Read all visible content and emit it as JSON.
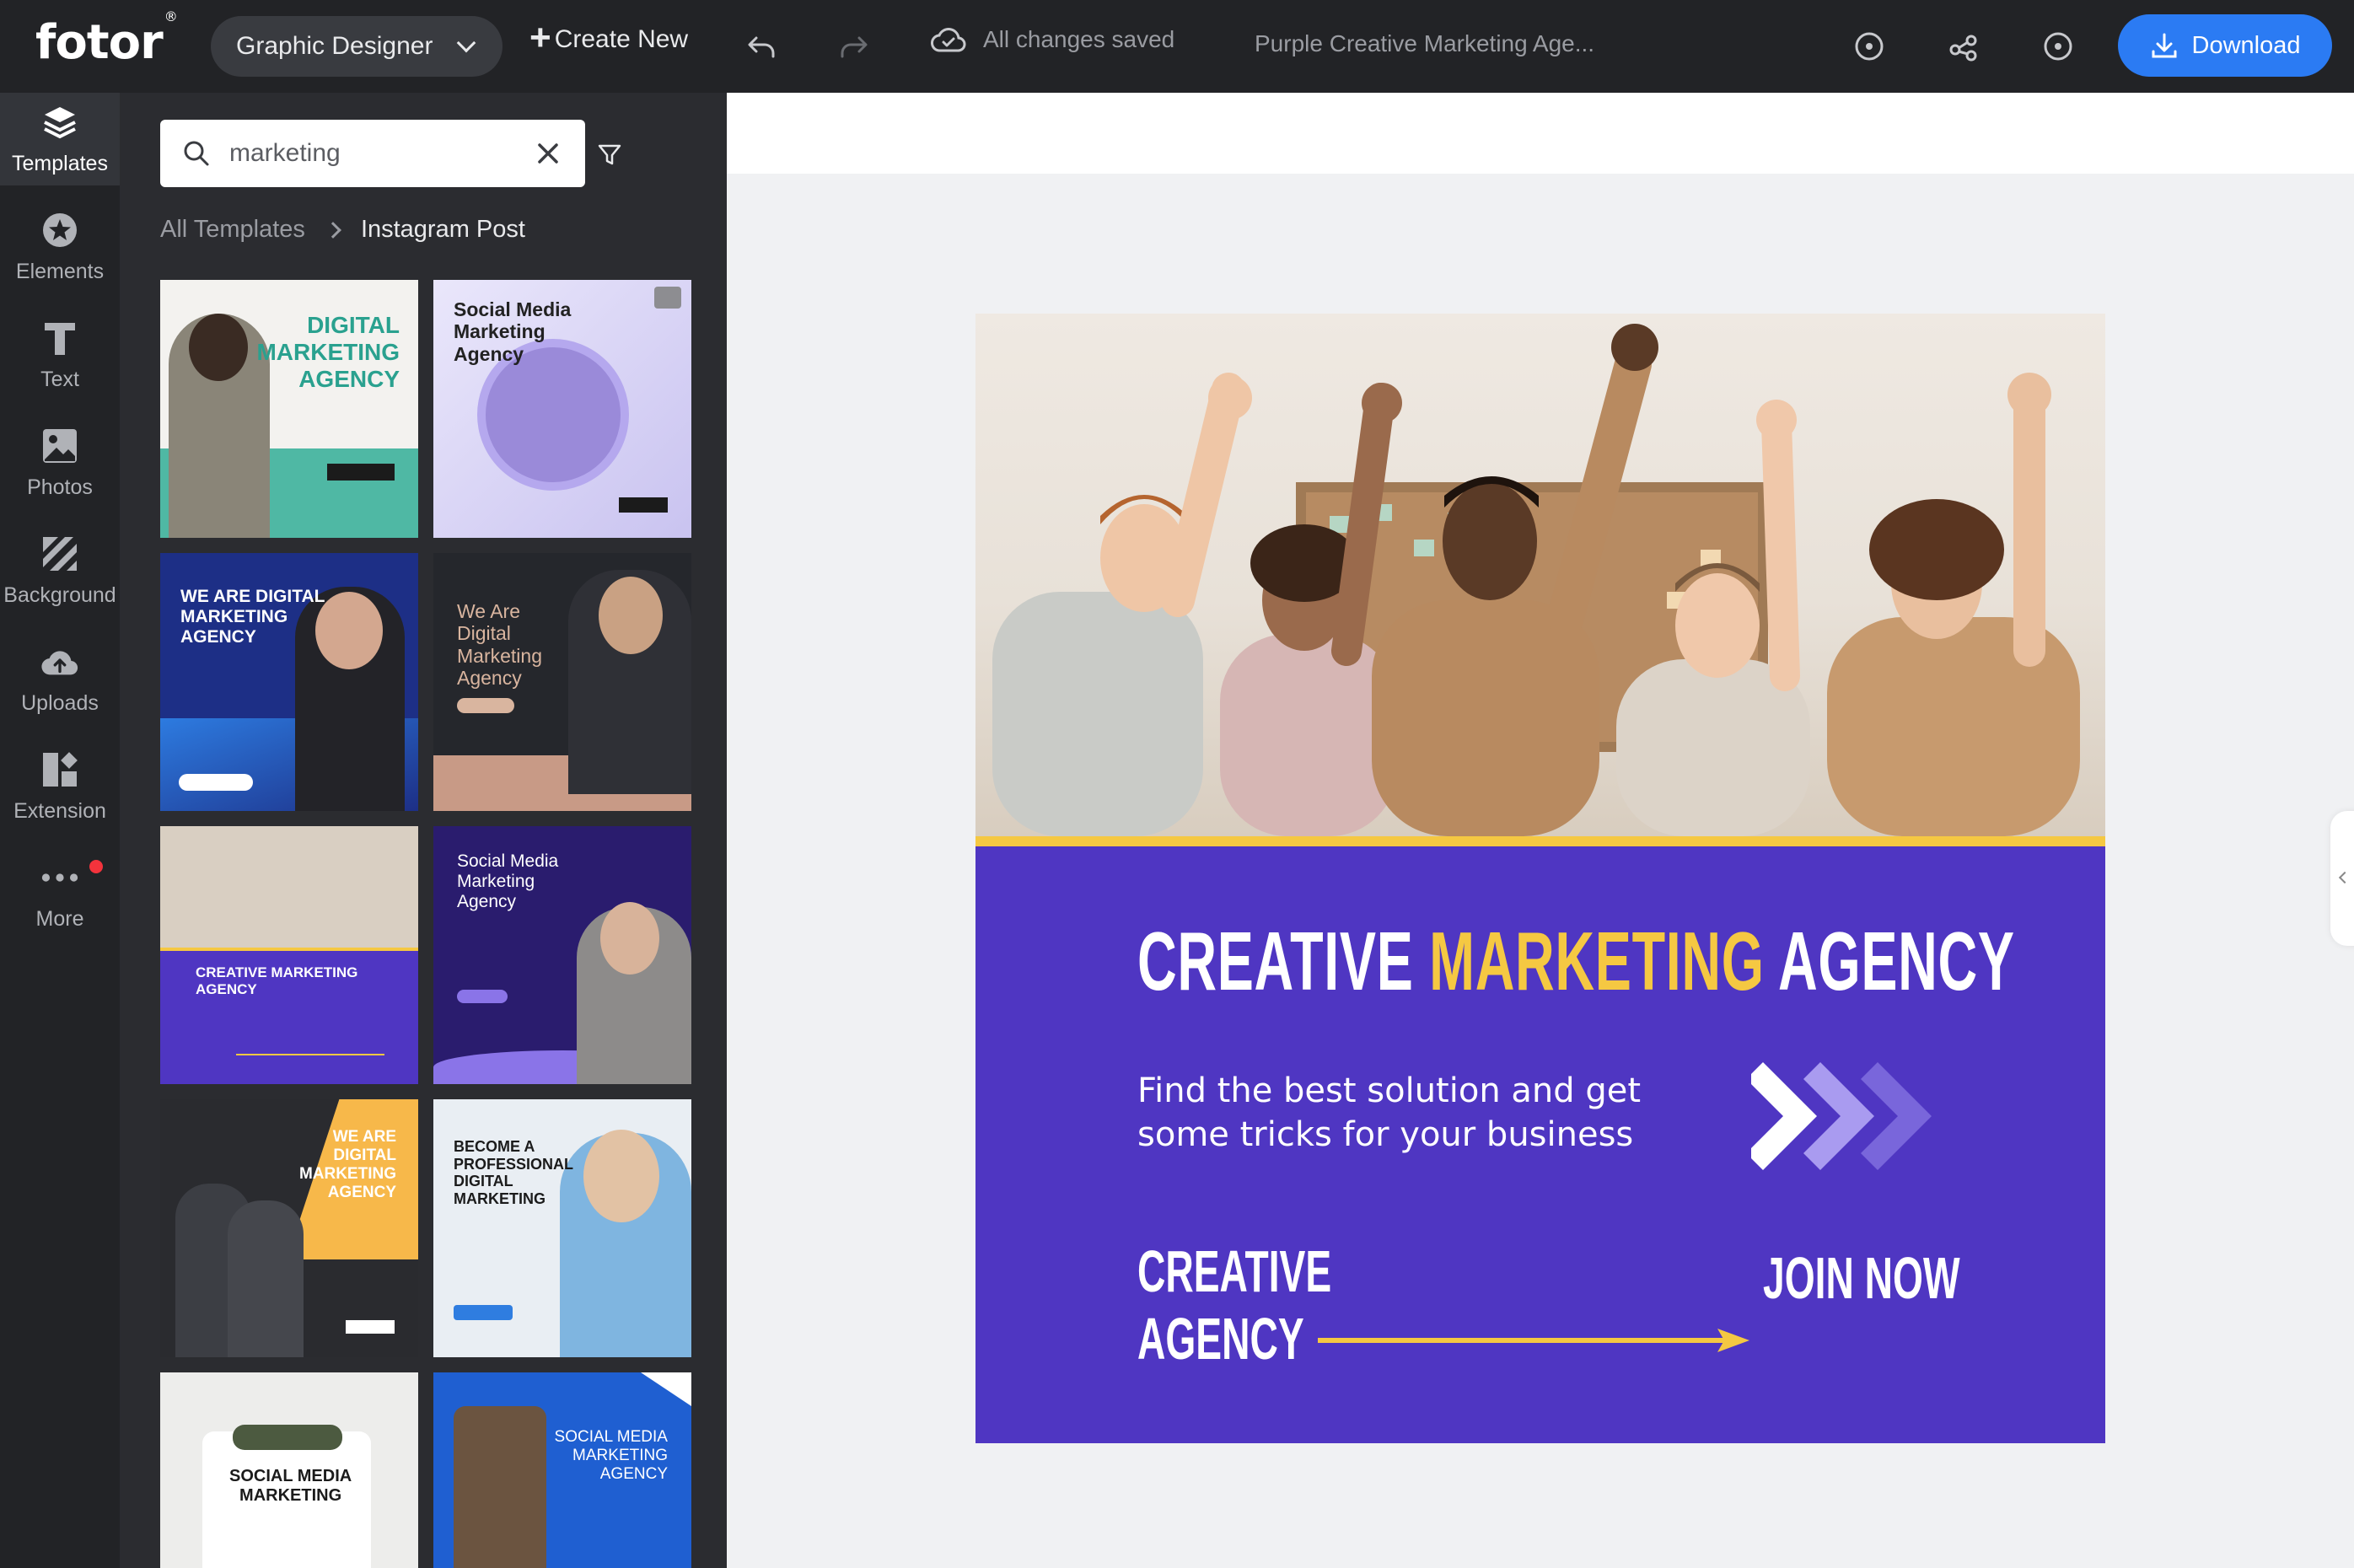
{
  "topbar": {
    "logo": "fotor",
    "logo_mark": "®",
    "role": "Graphic Designer",
    "create_new": "Create New",
    "save_status": "All changes saved",
    "doc_title": "Purple Creative Marketing Age...",
    "download": "Download"
  },
  "rail": {
    "items": [
      {
        "label": "Templates",
        "icon": "layers-icon"
      },
      {
        "label": "Elements",
        "icon": "star-icon"
      },
      {
        "label": "Text",
        "icon": "text-icon"
      },
      {
        "label": "Photos",
        "icon": "image-icon"
      },
      {
        "label": "Background",
        "icon": "background-icon"
      },
      {
        "label": "Uploads",
        "icon": "cloud-upload-icon"
      },
      {
        "label": "Extension",
        "icon": "extension-icon"
      },
      {
        "label": "More",
        "icon": "more-icon"
      }
    ]
  },
  "panel": {
    "search_value": "marketing",
    "breadcrumb_root": "All Templates",
    "breadcrumb_current": "Instagram Post",
    "templates": [
      {
        "text": "DIGITAL\nMARKETING\nAGENCY",
        "bg": "#f3f2ef"
      },
      {
        "text": "Social Media\nMarketing\nAgency",
        "bg": "#d9d4f4"
      },
      {
        "text": "WE ARE DIGITAL\nMARKETING\nAGENCY",
        "bg": "#1d2f86"
      },
      {
        "text": "We Are\nDigital\nMarketing\nAgency",
        "bg": "#25272c"
      },
      {
        "text": "CREATIVE MARKETING AGENCY",
        "bg": "#4f36c2"
      },
      {
        "text": "Social Media\nMarketing\nAgency",
        "bg": "#2a1c6e"
      },
      {
        "text": "WE ARE\nDIGITAL\nMARKETING\nAGENCY",
        "bg": "#f2f2f2"
      },
      {
        "text": "BECOME A\nPROFESSIONAL\nDIGITAL\nMARKETING",
        "bg": "#e9eef3"
      },
      {
        "text": "SOCIAL MEDIA\nMARKETING",
        "bg": "#ededeb"
      },
      {
        "text": "SOCIAL MEDIA\nMARKETING\nAGENCY",
        "bg": "#1f5fd1"
      }
    ]
  },
  "design": {
    "headline_pre": "CREATIVE ",
    "headline_highlight": "MARKETING",
    "headline_post": " AGENCY",
    "subtext": "Find the best solution and get some tricks for your business",
    "bottom_left": "CREATIVE\nAGENCY",
    "bottom_right": "JOIN NOW"
  },
  "colors": {
    "accent": "#2b7bf3",
    "design_purple": "#4f36c2",
    "design_yellow": "#f5c842",
    "topbar_bg": "#222326",
    "panel_bg": "#2b2c30"
  }
}
